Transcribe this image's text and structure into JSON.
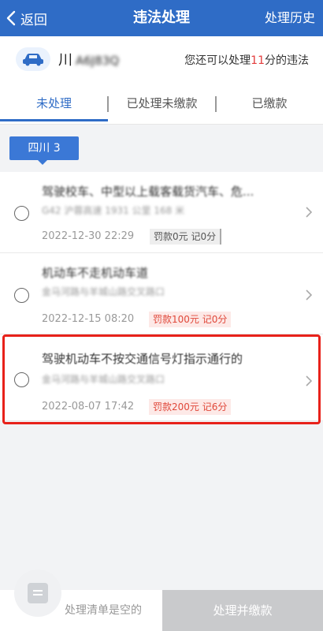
{
  "nav": {
    "back_label": "返回",
    "title": "违法处理",
    "history_label": "处理历史"
  },
  "vehicle": {
    "province": "川",
    "plate_rest": "A6J83Q",
    "remain_prefix": "您还可以处理",
    "remain_points": "11",
    "remain_suffix": "分的违法"
  },
  "tabs": [
    {
      "label": "未处理",
      "active": true
    },
    {
      "label": "已处理未缴款",
      "active": false
    },
    {
      "label": "已缴款",
      "active": false
    }
  ],
  "region_label": "四川 3",
  "violations": [
    {
      "title": "驾驶校车、中型以上载客载货汽车、危...",
      "location": "G42 沪蓉高速 1931 公里 168 米",
      "datetime": "2022-12-30 22:29",
      "fine": "罚款0元",
      "points": "记0分"
    },
    {
      "title": "机动车不走机动车道",
      "location": "金马河路与羊城山路交叉路口",
      "datetime": "2022-12-15 08:20",
      "fine": "罚款100元",
      "points": "记0分"
    },
    {
      "title": "驾驶机动车不按交通信号灯指示通行的",
      "location": "金马河路与羊城山路交叉路口",
      "datetime": "2022-08-07 17:42",
      "fine": "罚款200元",
      "points": "记6分"
    }
  ],
  "bottom": {
    "empty_label": "处理清单是空的",
    "pay_label": "处理并缴款"
  },
  "colors": {
    "brand": "#2f6cc6",
    "fine_red": "#e0483a",
    "highlight": "#e8211a"
  }
}
